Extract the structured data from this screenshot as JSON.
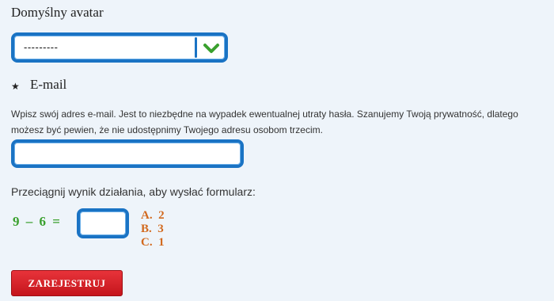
{
  "avatar": {
    "label": "Domyślny avatar",
    "selected_value": "---------",
    "chevron_icon": "chevron-down-icon"
  },
  "email": {
    "label": "E-mail",
    "required_icon": "star-icon",
    "help_text": "Wpisz swój adres e-mail. Jest to niezbędne na wypadek ewentualnej utraty hasła. Szanujemy Twoją prywatność, dlatego możesz być pewien, że nie udostępnimy Twojego adresu osobom trzecim.",
    "value": ""
  },
  "captcha": {
    "instructions": "Przeciągnij wynik działania, aby wysłać formularz:",
    "equation": "9 – 6 =",
    "options": [
      "A.  2",
      "B.  3",
      "C.  1"
    ]
  },
  "register_button": {
    "label": "ZAREJESTRUJ"
  },
  "colors": {
    "field_border": "#1a73c4",
    "check_green": "#3aa02e",
    "option_orange": "#d2691e",
    "button_red": "#d4232a",
    "background": "#eef4fa"
  }
}
